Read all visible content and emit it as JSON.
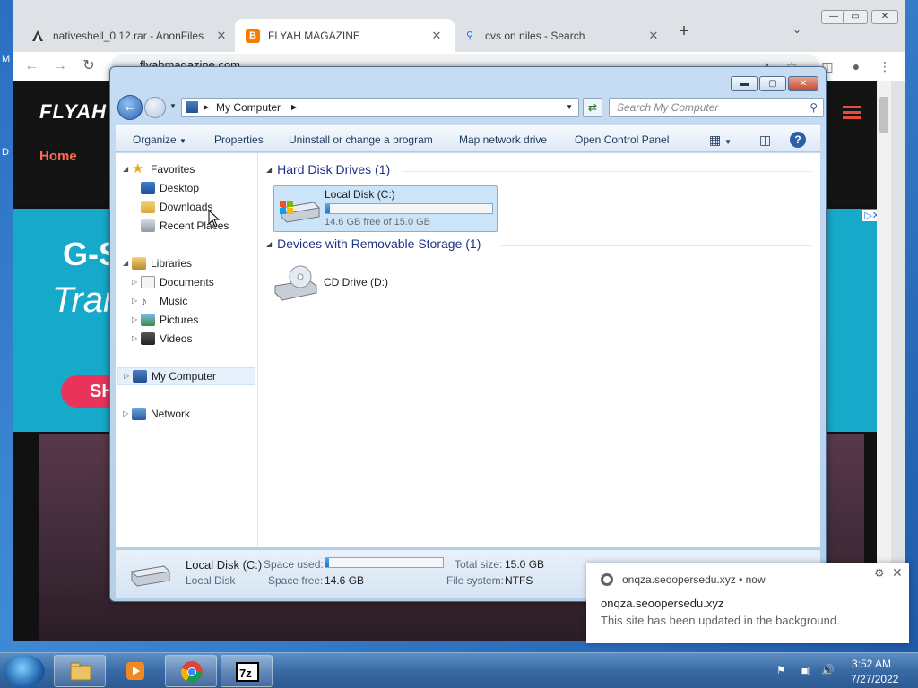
{
  "desktop": {
    "edge_char1": "M",
    "edge_char2": "D"
  },
  "browser": {
    "tabs": [
      {
        "title": "nativeshell_0.12.rar - AnonFiles",
        "icon": "anonfiles-icon"
      },
      {
        "title": "FLYAH MAGAZINE",
        "icon": "blogger-icon"
      },
      {
        "title": "cvs on niles - Search",
        "icon": "search-icon"
      }
    ],
    "new_tab": "+",
    "address": "flyahmagazine.com",
    "window_controls": {
      "minimize": "—",
      "maximize": "▭",
      "close": "✕"
    }
  },
  "site": {
    "logo": "FLYAH",
    "nav_home": "Home",
    "banner_line1": "G-S",
    "banner_line2": "Tran",
    "banner_button": "SH",
    "ad_choices": "▷✕"
  },
  "explorer": {
    "address": "My Computer",
    "search_placeholder": "Search My Computer",
    "commands": [
      "Organize",
      "Properties",
      "Uninstall or change a program",
      "Map network drive",
      "Open Control Panel"
    ],
    "nav": {
      "favorites": "Favorites",
      "desktop": "Desktop",
      "downloads": "Downloads",
      "recent_places": "Recent Places",
      "libraries": "Libraries",
      "documents": "Documents",
      "music": "Music",
      "pictures": "Pictures",
      "videos": "Videos",
      "my_computer": "My Computer",
      "network": "Network"
    },
    "groups": {
      "hard_disk": "Hard Disk Drives (1)",
      "removable": "Devices with Removable Storage (1)"
    },
    "drive_c": {
      "name": "Local Disk (C:)",
      "free_text": "14.6 GB free of 15.0 GB",
      "used_fraction": 0.027
    },
    "drive_d": {
      "name": "CD Drive (D:)"
    },
    "details": {
      "name": "Local Disk (C:)",
      "type": "Local Disk",
      "space_used_label": "Space used:",
      "space_free_label": "Space free:",
      "space_free": "14.6 GB",
      "total_size_label": "Total size:",
      "total_size": "15.0 GB",
      "file_system_label": "File system:",
      "file_system": "NTFS"
    }
  },
  "notification": {
    "origin": "onqza.seoopersedu.xyz  •  now",
    "title": "onqza.seoopersedu.xyz",
    "body": "This site has been updated in the background."
  },
  "taskbar": {
    "apps": [
      "explorer-icon",
      "media-player-icon",
      "chrome-icon",
      "7zip-icon"
    ],
    "time": "3:52 AM",
    "date": "7/27/2022"
  },
  "colors": {
    "accent": "#1e3287",
    "site_accent": "#e64a3b",
    "progress": "#1e78c8"
  }
}
